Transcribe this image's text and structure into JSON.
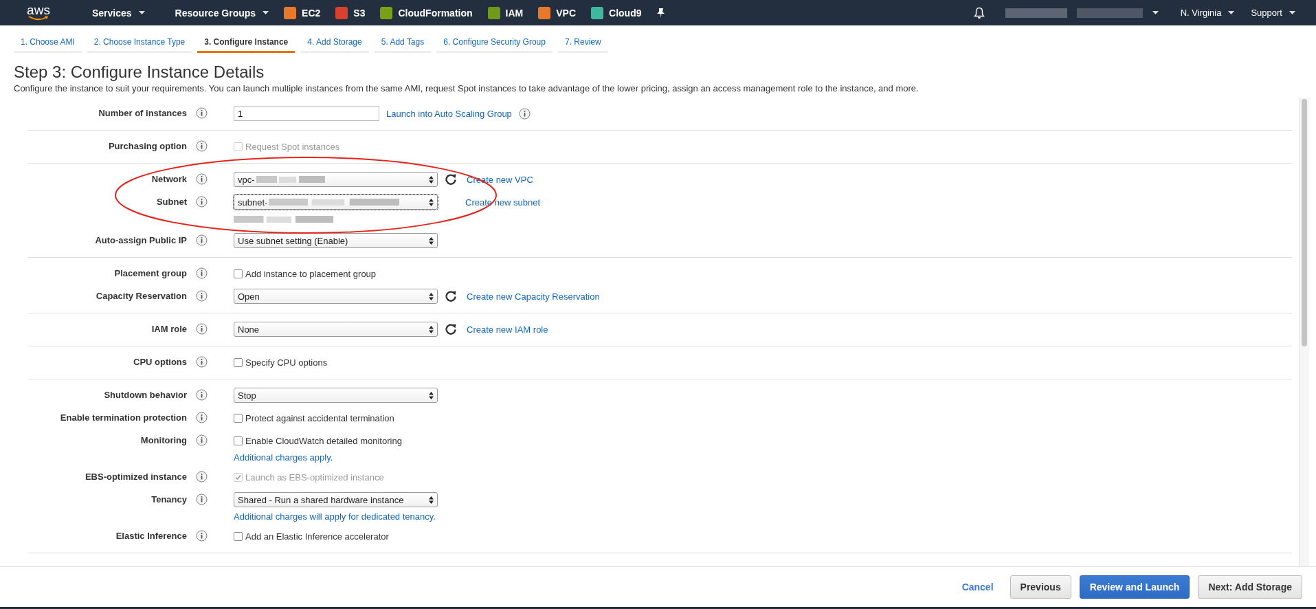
{
  "top_bar": {
    "logo": "aws",
    "menus": [
      {
        "label": "Services"
      },
      {
        "label": "Resource Groups"
      }
    ],
    "shortcuts": [
      {
        "label": "EC2",
        "color": "#e8792a"
      },
      {
        "label": "S3",
        "color": "#d9402f"
      },
      {
        "label": "CloudFormation",
        "color": "#7aa116"
      },
      {
        "label": "IAM",
        "color": "#6f9a1c"
      },
      {
        "label": "VPC",
        "color": "#e8792a"
      },
      {
        "label": "Cloud9",
        "color": "#3fb8a0"
      }
    ],
    "account_redacted": true,
    "region": "N. Virginia",
    "support": "Support"
  },
  "wizard_tabs": [
    {
      "label": "1. Choose AMI",
      "selected": false
    },
    {
      "label": "2. Choose Instance Type",
      "selected": false
    },
    {
      "label": "3. Configure Instance",
      "selected": true
    },
    {
      "label": "4. Add Storage",
      "selected": false
    },
    {
      "label": "5. Add Tags",
      "selected": false
    },
    {
      "label": "6. Configure Security Group",
      "selected": false
    },
    {
      "label": "7. Review",
      "selected": false
    }
  ],
  "heading": "Step 3: Configure Instance Details",
  "description": "Configure the instance to suit your requirements. You can launch multiple instances from the same AMI, request Spot instances to take advantage of the lower pricing, assign an access management role to the instance, and more.",
  "sections": [
    {
      "rows": [
        {
          "label": "Number of instances",
          "kind": "input",
          "value": "1",
          "link": "Launch into Auto Scaling Group",
          "link_info": true
        }
      ]
    },
    {
      "rows": [
        {
          "label": "Purchasing option",
          "kind": "checkbox",
          "text": "Request Spot instances",
          "checked": false,
          "disabled": true
        }
      ]
    },
    {
      "highlighted": true,
      "rows": [
        {
          "label": "Network",
          "kind": "select",
          "value": "vpc-",
          "redacted": true,
          "refresh": true,
          "link": "Create new VPC"
        },
        {
          "label": "Subnet",
          "kind": "select",
          "value": "subnet-",
          "redacted": true,
          "focused": true,
          "link": "Create new subnet",
          "redacted_line": true
        },
        {
          "label": "Auto-assign Public IP",
          "kind": "select",
          "value": "Use subnet setting (Enable)"
        }
      ]
    },
    {
      "rows": [
        {
          "label": "Placement group",
          "kind": "checkbox",
          "text": "Add instance to placement group",
          "checked": false,
          "disabled": false
        },
        {
          "label": "Capacity Reservation",
          "kind": "select",
          "value": "Open",
          "refresh": true,
          "link": "Create new Capacity Reservation"
        }
      ]
    },
    {
      "rows": [
        {
          "label": "IAM role",
          "kind": "select",
          "value": "None",
          "refresh": true,
          "link": "Create new IAM role"
        }
      ]
    },
    {
      "rows": [
        {
          "label": "CPU options",
          "kind": "checkbox",
          "text": "Specify CPU options",
          "checked": false,
          "disabled": false
        }
      ]
    },
    {
      "rows": [
        {
          "label": "Shutdown behavior",
          "kind": "select",
          "value": "Stop"
        },
        {
          "label": "Enable termination protection",
          "kind": "checkbox",
          "text": "Protect against accidental termination",
          "checked": false,
          "disabled": false
        },
        {
          "label": "Monitoring",
          "kind": "checkbox",
          "text": "Enable CloudWatch detailed monitoring",
          "checked": false,
          "disabled": false,
          "note": "Additional charges apply."
        },
        {
          "label": "EBS-optimized instance",
          "kind": "checkbox",
          "text": "Launch as EBS-optimized instance",
          "checked": true,
          "disabled": true
        },
        {
          "label": "Tenancy",
          "kind": "select",
          "value": "Shared - Run a shared hardware instance",
          "note": "Additional charges will apply for dedicated tenancy."
        },
        {
          "label": "Elastic Inference",
          "kind": "checkbox",
          "text": "Add an Elastic Inference accelerator",
          "checked": false,
          "disabled": false
        }
      ]
    }
  ],
  "footer": {
    "buttons": [
      {
        "label": "Cancel",
        "kind": "link"
      },
      {
        "label": "Previous",
        "kind": "secondary"
      },
      {
        "label": "Review and Launch",
        "kind": "primary"
      },
      {
        "label": "Next: Add Storage",
        "kind": "secondary"
      }
    ]
  }
}
